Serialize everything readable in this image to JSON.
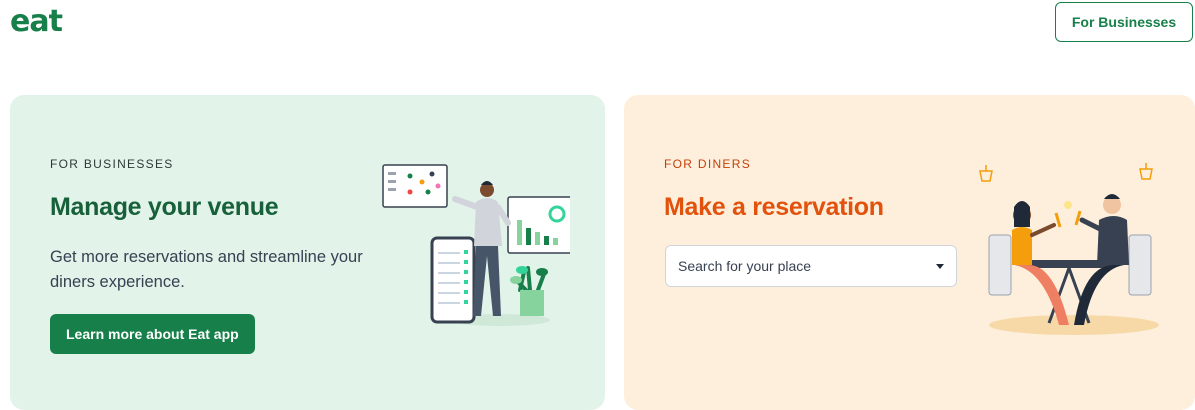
{
  "header": {
    "logo": "eat",
    "for_businesses_label": "For Businesses"
  },
  "business_card": {
    "eyebrow": "FOR BUSINESSES",
    "title": "Manage your venue",
    "description": "Get more reservations and streamline your diners experience.",
    "cta_label": "Learn more about Eat app"
  },
  "diner_card": {
    "eyebrow": "FOR DINERS",
    "title": "Make a reservation",
    "search_placeholder": "Search for your place"
  },
  "colors": {
    "brand_green": "#17804a",
    "business_bg": "#e2f3e9",
    "diner_bg": "#fdefdb",
    "diner_accent": "#e2520d"
  }
}
